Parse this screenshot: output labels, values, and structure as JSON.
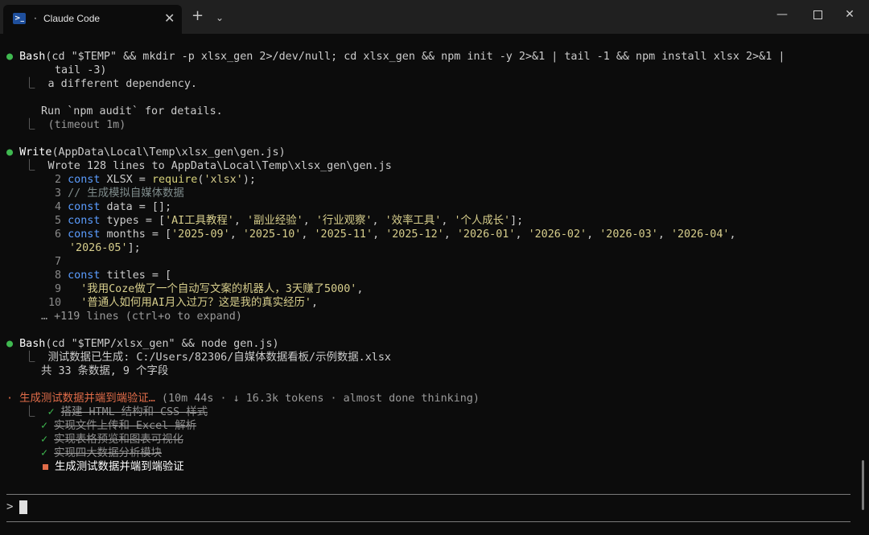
{
  "window": {
    "tab_title": "Claude Code",
    "tab_dot": "·",
    "tab_icon": "PowerShell",
    "close_glyph": "✕",
    "newtab_glyph": "+",
    "dropdown_glyph": "⌄",
    "min_glyph": "—",
    "close_win_glyph": "✕"
  },
  "bullets": {
    "dot": "●",
    "progress": "·",
    "tree": "⎿",
    "check": "✓"
  },
  "bash1": {
    "tool": "Bash",
    "args_line1": "(cd \"$TEMP\" && mkdir -p xlsx_gen 2>/dev/null; cd xlsx_gen && npm init -y 2>&1 | tail -1 && npm install xlsx 2>&1 |",
    "args_line2": "tail -3)",
    "out1": "a different dependency.",
    "out2": "Run `npm audit` for details.",
    "timeout": "(timeout 1m)"
  },
  "write": {
    "tool": "Write",
    "args": "(AppData\\Local\\Temp\\xlsx_gen\\gen.js)",
    "summary": "Wrote 128 lines to AppData\\Local\\Temp\\xlsx_gen\\gen.js",
    "more": "… +119 lines (ctrl+o to expand)",
    "code": {
      "n2": "2",
      "l2_kw": "const",
      "l2_a": " XLSX = ",
      "l2_fn": "require",
      "l2_b": "(",
      "l2_str": "'xlsx'",
      "l2_c": ");",
      "n3": "3",
      "l3_cmt": "// 生成模拟自媒体数据",
      "n4": "4",
      "l4_kw": "const",
      "l4_a": " data = [];",
      "n5": "5",
      "l5_kw": "const",
      "l5_a": " types = [",
      "l5_s1": "'AI工具教程'",
      "l5_s2": "'副业经验'",
      "l5_s3": "'行业观察'",
      "l5_s4": "'效率工具'",
      "l5_s5": "'个人成长'",
      "l5_b": "];",
      "comma": ", ",
      "n6": "6",
      "l6_kw": "const",
      "l6_a": " months = [",
      "l6_s1": "'2025-09'",
      "l6_s2": "'2025-10'",
      "l6_s3": "'2025-11'",
      "l6_s4": "'2025-12'",
      "l6_s5": "'2026-01'",
      "l6_s6": "'2026-02'",
      "l6_s7": "'2026-03'",
      "l6_s8": "'2026-04'",
      "l6_tail": ",",
      "l6b_s9": "'2026-05'",
      "l6b_b": "];",
      "n7": "7",
      "n8": "8",
      "l8_kw": "const",
      "l8_a": " titles = [",
      "n9": "9",
      "l9_str": "'我用Coze做了一个自动写文案的机器人，3天赚了5000'",
      "l9_b": ",",
      "n10": "10",
      "l10_str": "'普通人如何用AI月入过万？这是我的真实经历'",
      "l10_b": ","
    }
  },
  "bash2": {
    "tool": "Bash",
    "args": "(cd \"$TEMP/xlsx_gen\" && node gen.js)",
    "out1": "测试数据已生成: C:/Users/82306/自媒体数据看板/示例数据.xlsx",
    "out2": "共 33 条数据, 9 个字段"
  },
  "status": {
    "task": "生成测试数据并端到端验证…",
    "meta": " (10m 44s · ↓ 16.3k tokens · almost done thinking)"
  },
  "todos": [
    {
      "label": "搭建 HTML 结构和 CSS 样式",
      "done": true
    },
    {
      "label": "实现文件上传和 Excel 解析",
      "done": true
    },
    {
      "label": "实现表格预览和图表可视化",
      "done": true
    },
    {
      "label": "实现四大数据分析模块",
      "done": true
    },
    {
      "label": "生成测试数据并端到端验证",
      "done": false
    }
  ],
  "input": {
    "prompt": ">"
  },
  "colors": {
    "background": "#0c0c0c",
    "titlebar": "#202020",
    "success": "#3fb950",
    "accent": "#e06c49",
    "keyword": "#5b9dff",
    "string": "#d7ce8c"
  }
}
